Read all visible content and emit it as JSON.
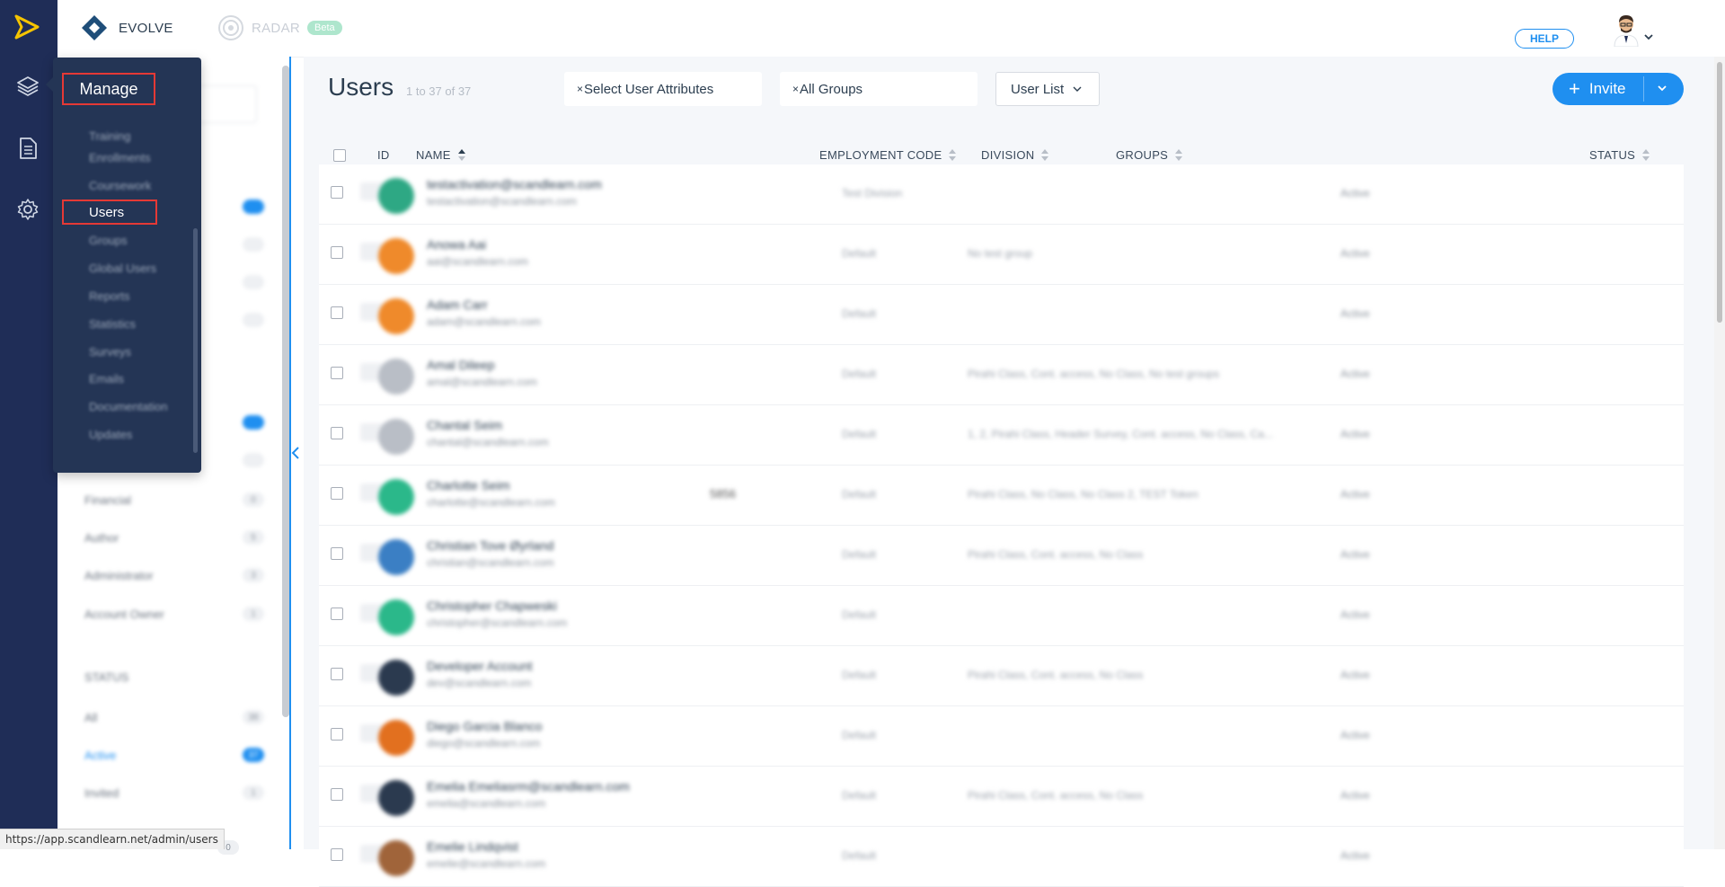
{
  "topbar": {
    "apps": [
      {
        "name": "EVOLVE"
      },
      {
        "name": "RADAR",
        "badge": "Beta"
      }
    ],
    "help_label": "HELP"
  },
  "manage_menu": {
    "title": "Manage",
    "items": [
      "Training",
      "Enrollments",
      "Coursework",
      "Users",
      "Groups",
      "Global Users",
      "Reports",
      "Statistics",
      "Surveys",
      "Emails",
      "Documentation",
      "Updates"
    ],
    "highlighted": "Users"
  },
  "filter_panel": {
    "sections": [
      {
        "label": "Financial",
        "count": "0"
      },
      {
        "label": "Author",
        "count": "5"
      },
      {
        "label": "Administrator",
        "count": "3"
      },
      {
        "label": "Account Owner",
        "count": "1"
      }
    ],
    "status_heading": "STATUS",
    "status": [
      {
        "label": "All",
        "count": "38"
      },
      {
        "label": "Active",
        "count": "37",
        "active": true
      },
      {
        "label": "Invited",
        "count": "1"
      }
    ],
    "bottom_count": "0"
  },
  "main": {
    "title": "Users",
    "count_text": "1 to 37 of 37",
    "filters": {
      "attributes": "Select User Attributes",
      "groups": "All Groups",
      "remove_symbol": "×"
    },
    "view_select": "User List",
    "invite_label": "Invite"
  },
  "table": {
    "columns": {
      "id": "ID",
      "name": "NAME",
      "employment_code": "EMPLOYMENT CODE",
      "division": "DIVISION",
      "groups": "GROUPS",
      "status": "STATUS"
    },
    "rows": [
      {
        "name": "testactivation@scandlearn.com",
        "email": "testactivation@scandlearn.com",
        "code": "",
        "division": "Test Division",
        "groups": "",
        "status": "Active",
        "avatar_color": "#2ea884"
      },
      {
        "name": "Anowa Aai",
        "email": "aai@scandlearn.com",
        "code": "",
        "division": "Default",
        "groups": "No test group",
        "status": "Active",
        "avatar_color": "#ef8a2b"
      },
      {
        "name": "Adam Carr",
        "email": "adam@scandlearn.com",
        "code": "",
        "division": "Default",
        "groups": "",
        "status": "Active",
        "avatar_color": "#ef8a2b"
      },
      {
        "name": "Amal Dileep",
        "email": "amal@scandlearn.com",
        "code": "",
        "division": "Default",
        "groups": "Pirahi Class, Cont. access, No Class, No test groups",
        "status": "Active",
        "avatar_color": "#b9bec6"
      },
      {
        "name": "Chantal Seim",
        "email": "chantal@scandlearn.com",
        "code": "",
        "division": "Default",
        "groups": "1, 2, Pirahi Class, Header Survey, Cont. access, No Class, Ca...",
        "status": "Active",
        "avatar_color": "#b9bec6"
      },
      {
        "name": "Charlotte Seim",
        "email": "charlotte@scandlearn.com",
        "code": "5856",
        "division": "Default",
        "groups": "Pirahi Class, No Class, No Class 2, TEST Token",
        "status": "Active",
        "avatar_color": "#2bb88a"
      },
      {
        "name": "Christian Tove Øyrland",
        "email": "christian@scandlearn.com",
        "code": "",
        "division": "Default",
        "groups": "Pirahi Class, Cont. access, No Class",
        "status": "Active",
        "avatar_color": "#3b7fc4"
      },
      {
        "name": "Christopher Chapweski",
        "email": "christopher@scandlearn.com",
        "code": "",
        "division": "Default",
        "groups": "",
        "status": "Active",
        "avatar_color": "#2bb88a"
      },
      {
        "name": "Developer Account",
        "email": "dev@scandlearn.com",
        "code": "",
        "division": "Default",
        "groups": "Pirahi Class, Cont. access, No Class",
        "status": "Active",
        "avatar_color": "#2b3a4f"
      },
      {
        "name": "Diego Garcia Blanco",
        "email": "diego@scandlearn.com",
        "code": "",
        "division": "Default",
        "groups": "",
        "status": "Active",
        "avatar_color": "#e2701f"
      },
      {
        "name": "Emelia Emeliasrm@scandlearn.com",
        "email": "emelia@scandlearn.com",
        "code": "",
        "division": "Default",
        "groups": "Pirahi Class, Cont. access, No Class",
        "status": "Active",
        "avatar_color": "#2b3a4f"
      },
      {
        "name": "Emelie Lindqvist",
        "email": "emelie@scandlearn.com",
        "code": "",
        "division": "Default",
        "groups": "",
        "status": "Active",
        "avatar_color": "#a0643a"
      }
    ]
  },
  "status_bar": {
    "url": "https://app.scandlearn.net/admin/users"
  },
  "colors": {
    "rail": "#1f2d57",
    "accent": "#1f8ff0",
    "menu": "#243555",
    "highlight": "#e53935",
    "logo": "#f5c400"
  }
}
